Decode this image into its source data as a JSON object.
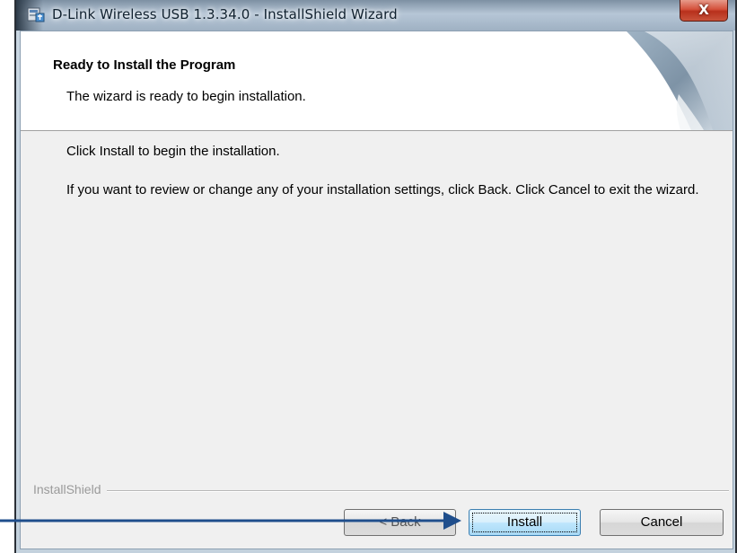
{
  "window": {
    "title": "D-Link Wireless USB 1.3.34.0 - InstallShield Wizard",
    "close_label": "X"
  },
  "banner": {
    "title": "Ready to Install the Program",
    "subtitle": "The wizard is ready to begin installation."
  },
  "content": {
    "line1": "Click Install to begin the installation.",
    "line2": "If you want to review or change any of your installation settings, click Back. Click Cancel to exit the wizard."
  },
  "footer": {
    "brand": "InstallShield"
  },
  "buttons": {
    "back": "< Back",
    "install": "Install",
    "cancel": "Cancel"
  },
  "annotation": {
    "arrow_color": "#1f4e8c"
  }
}
